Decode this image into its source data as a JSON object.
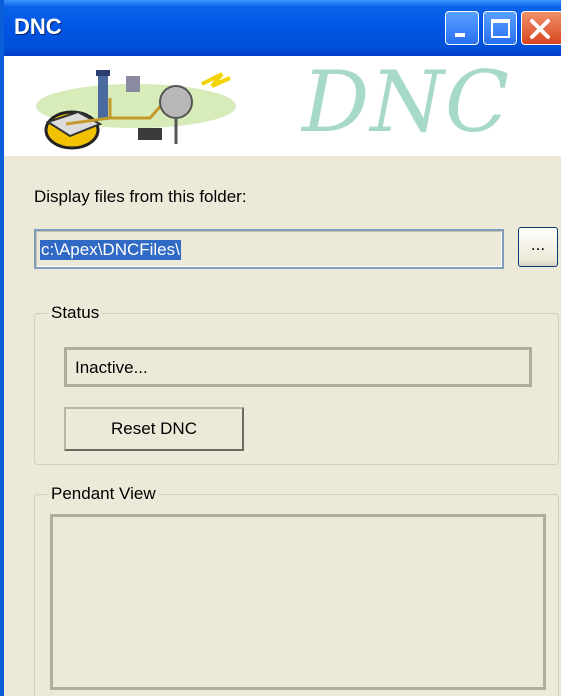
{
  "window": {
    "title": "DNC",
    "controls": {
      "minimize": "minimize",
      "maximize": "maximize",
      "close": "close"
    }
  },
  "banner": {
    "brand_text": "DNC",
    "logo_icon": "network-devices-icon"
  },
  "folder": {
    "label": "Display files from this folder:",
    "value": "c:\\Apex\\DNCFiles\\",
    "browse_label": "..."
  },
  "status": {
    "group_title": "Status",
    "value": "Inactive...",
    "reset_label": "Reset DNC"
  },
  "pendant": {
    "group_title": "Pendant View"
  },
  "colors": {
    "titlebar": "#0054e3",
    "window_bg": "#ece9d8",
    "selection": "#316ac5",
    "brand": "#a7d9ca"
  }
}
